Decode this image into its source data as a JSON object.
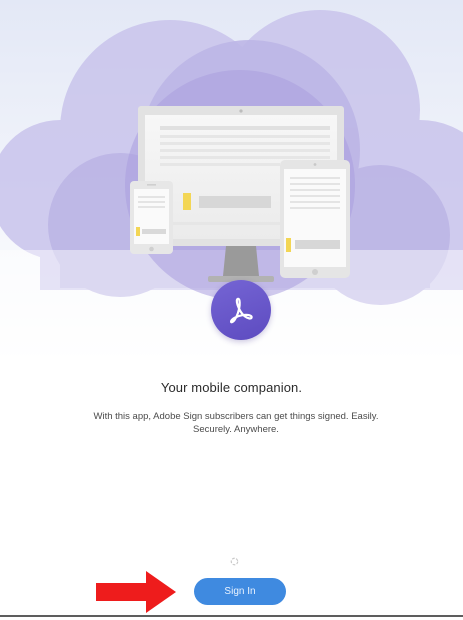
{
  "welcome": {
    "headline": "Your mobile companion.",
    "description": "With this app, Adobe Sign subscribers can get things signed. Easily. Securely. Anywhere."
  },
  "actions": {
    "sign_in_label": "Sign In"
  },
  "icons": {
    "logo": "adobe-acrobat-sign-icon",
    "loading": "loading-spinner-icon",
    "annotation": "red-arrow-icon"
  },
  "colors": {
    "brand_purple": "#5d4bc0",
    "button_blue": "#3f8ae0",
    "annotation_red": "#ee1c1c",
    "cloud_lavender": "#b7b0e3"
  }
}
